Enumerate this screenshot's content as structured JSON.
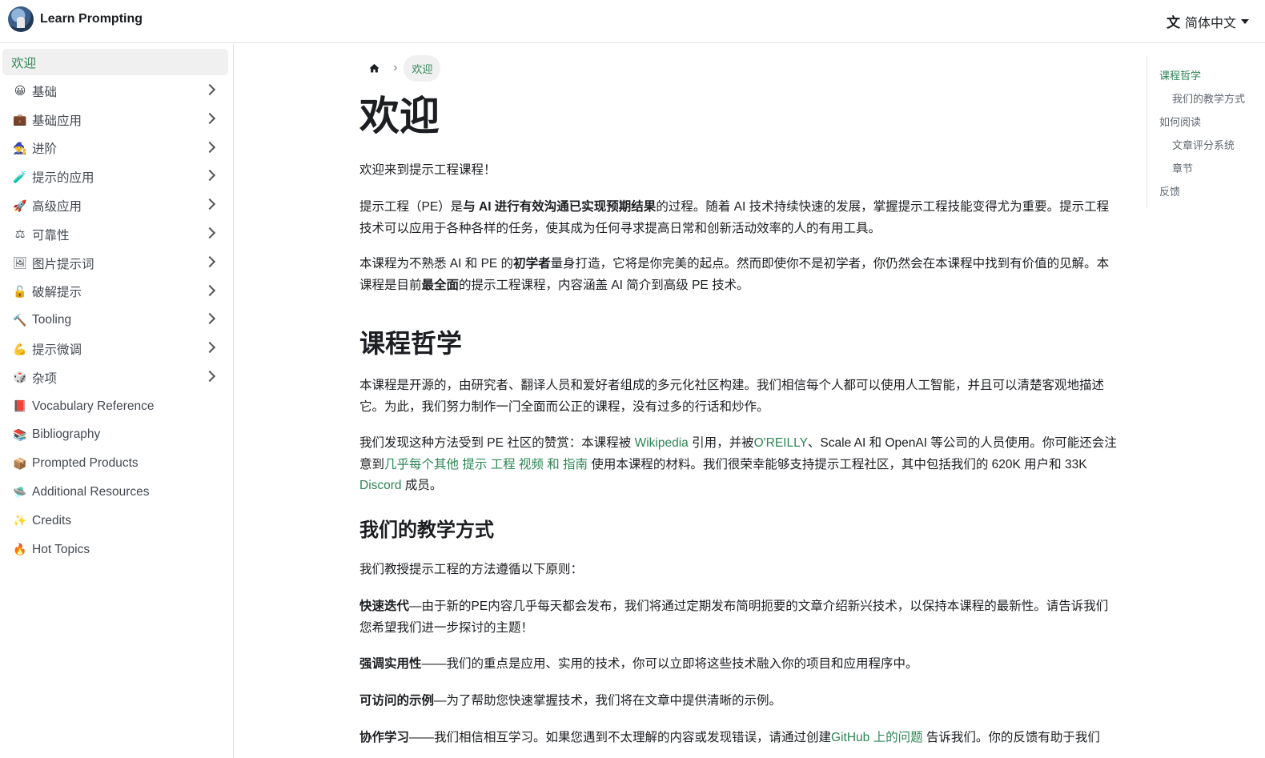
{
  "navbar": {
    "brand": "Learn Prompting",
    "language": "简体中文"
  },
  "sidebar": {
    "items": [
      {
        "label": "欢迎",
        "emoji": "",
        "active": true,
        "expandable": false
      },
      {
        "label": "基础",
        "emoji": "😀",
        "expandable": true
      },
      {
        "label": "基础应用",
        "emoji": "💼",
        "expandable": true
      },
      {
        "label": "进阶",
        "emoji": "🧙",
        "expandable": true
      },
      {
        "label": "提示的应用",
        "emoji": "🧪",
        "expandable": true
      },
      {
        "label": "高级应用",
        "emoji": "🚀",
        "expandable": true
      },
      {
        "label": "可靠性",
        "emoji": "⚖",
        "expandable": true
      },
      {
        "label": "图片提示词",
        "emoji": "🖼",
        "expandable": true
      },
      {
        "label": "破解提示",
        "emoji": "🔓",
        "expandable": true
      },
      {
        "label": "Tooling",
        "emoji": "🔨",
        "expandable": true
      },
      {
        "label": "提示微调",
        "emoji": "💪",
        "expandable": true
      },
      {
        "label": "杂项",
        "emoji": "🎲",
        "expandable": true
      },
      {
        "label": "Vocabulary Reference",
        "emoji": "📕",
        "expandable": false
      },
      {
        "label": "Bibliography",
        "emoji": "📚",
        "expandable": false
      },
      {
        "label": "Prompted Products",
        "emoji": "📦",
        "expandable": false
      },
      {
        "label": "Additional Resources",
        "emoji": "🛸",
        "expandable": false
      },
      {
        "label": "Credits",
        "emoji": "✨",
        "expandable": false
      },
      {
        "label": "Hot Topics",
        "emoji": "🔥",
        "expandable": false
      }
    ]
  },
  "breadcrumb": {
    "current": "欢迎"
  },
  "content": {
    "title": "欢迎",
    "intro": "欢迎来到提示工程课程！",
    "p1": {
      "a": "提示工程（PE）是",
      "b": "与 AI 进行有效沟通已实现预期结果",
      "c": "的过程。随着 AI 技术持续快速的发展，掌握提示工程技能变得尤为重要。提示工程技术可以应用于各种各样的任务，使其成为任何寻求提高日常和创新活动效率的人的有用工具。"
    },
    "p2": {
      "a": "本课程为不熟悉 AI 和 PE 的",
      "b": "初学者",
      "c": "量身打造，它将是你完美的起点。然而即使你不是初学者，你仍然会在本课程中找到有价值的见解。本课程是目前",
      "d": "最全面",
      "e": "的提示工程课程，内容涵盖 AI 简介到高级 PE 技术。"
    },
    "h2": "课程哲学",
    "p3": "本课程是开源的，由研究者、翻译人员和爱好者组成的多元化社区构建。我们相信每个人都可以使用人工智能，并且可以清楚客观地描述它。为此，我们努力制作一门全面而公正的课程，没有过多的行话和炒作。",
    "p4": {
      "a": "我们发现这种方法受到 PE 社区的赞赏：本课程被 ",
      "link1": "Wikipedia",
      "b": " 引用，并被",
      "link2": "O'REILLY",
      "c": "、Scale AI 和 OpenAI 等公司的人员使用。你可能还会注意到",
      "link3": "几乎每个其他 提示 工程 视频 和 指南",
      "d": " 使用本课程的材料。我们很荣幸能够支持提示工程社区，其中包括我们的 620K 用户和 33K ",
      "link4": "Discord",
      "e": " 成员。"
    },
    "h3": "我们的教学方式",
    "p5": "我们教授提示工程的方法遵循以下原则：",
    "p6": {
      "b": "快速迭代",
      "t": "—由于新的PE内容几乎每天都会发布，我们将通过定期发布简明扼要的文章介绍新兴技术，以保持本课程的最新性。请告诉我们您希望我们进一步探讨的主题！"
    },
    "p7": {
      "b": "强调实用性",
      "t": "——我们的重点是应用、实用的技术，你可以立即将这些技术融入你的项目和应用程序中。"
    },
    "p8": {
      "b": "可访问的示例",
      "t": "—为了帮助您快速掌握技术，我们将在文章中提供清晰的示例。"
    },
    "p9": {
      "b": "协作学习",
      "t": "——我们相信相互学习。如果您遇到不太理解的内容或发现错误，请通过创建",
      "link": "GitHub 上的问题",
      "t2": " 告诉我们。你的反馈有助于我们"
    }
  },
  "toc": {
    "items": [
      {
        "label": "课程哲学",
        "level": 2,
        "active": true
      },
      {
        "label": "我们的教学方式",
        "level": 3
      },
      {
        "label": "如何阅读",
        "level": 2
      },
      {
        "label": "文章评分系统",
        "level": 3
      },
      {
        "label": "章节",
        "level": 3
      },
      {
        "label": "反馈",
        "level": 2
      }
    ]
  },
  "colors": {
    "accent": "#2e8555",
    "text": "#1c1e21",
    "sidebar_active_bg": "#f0f0f0"
  }
}
